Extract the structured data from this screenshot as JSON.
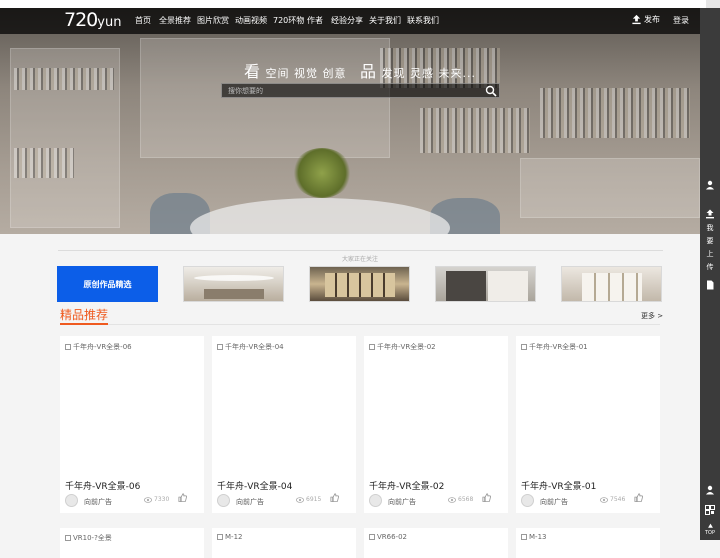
{
  "logo": {
    "text": "720",
    "suffix": "yun"
  },
  "nav": {
    "items": [
      "首页",
      "全景推荐",
      "图片欣赏",
      "动画视频",
      "720环物",
      "作者",
      "经验分享",
      "关于我们",
      "联系我们"
    ],
    "publish": "发布",
    "login": "登录"
  },
  "hero": {
    "slogan_big1": "看",
    "slogan_part1": "空间 视觉 创意",
    "slogan_big2": "品",
    "slogan_part2": "发现 灵感 未来...",
    "search_placeholder": "搜你想要的"
  },
  "rail": {
    "upload_text": [
      "我",
      "要",
      "上",
      "传"
    ],
    "top_text": "TOP"
  },
  "attention": {
    "text": "大家正在关注"
  },
  "banners": {
    "featured_label": "原创作品精选"
  },
  "section": {
    "title": "精品推荐",
    "more": "更多 >"
  },
  "cards": [
    {
      "alt": "千年舟-VR全景-06",
      "title": "千年舟-VR全景-06",
      "author": "向前广告",
      "views": "7330"
    },
    {
      "alt": "千年舟-VR全景-04",
      "title": "千年舟-VR全景-04",
      "author": "向前广告",
      "views": "6915"
    },
    {
      "alt": "千年舟-VR全景-02",
      "title": "千年舟-VR全景-02",
      "author": "向前广告",
      "views": "6568"
    },
    {
      "alt": "千年舟-VR全景-01",
      "title": "千年舟-VR全景-01",
      "author": "向前广告",
      "views": "7546"
    }
  ],
  "cards_row2": [
    {
      "alt": "VR10-?全景"
    },
    {
      "alt": "M-12"
    },
    {
      "alt": "VR66-02"
    },
    {
      "alt": "M-13"
    }
  ],
  "colors": {
    "accent": "#ef5a1f",
    "banner_blue": "#0c5ee8",
    "nav_bg": "#000000"
  }
}
